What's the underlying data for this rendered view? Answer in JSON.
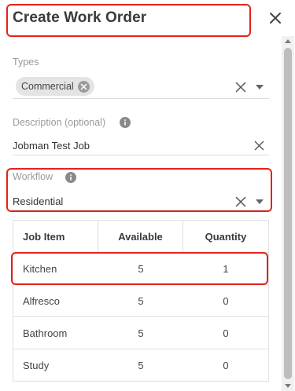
{
  "dialog": {
    "title": "Create Work Order"
  },
  "types": {
    "label": "Types",
    "selected_chip": "Commercial"
  },
  "description": {
    "label": "Description (optional)",
    "value": "Jobman Test Job"
  },
  "workflow": {
    "label": "Workflow",
    "value": "Residential"
  },
  "table": {
    "headers": [
      "Job Item",
      "Available",
      "Quantity"
    ],
    "rows": [
      {
        "item": "Kitchen",
        "available": "5",
        "quantity": "1"
      },
      {
        "item": "Alfresco",
        "available": "5",
        "quantity": "0"
      },
      {
        "item": "Bathroom",
        "available": "5",
        "quantity": "0"
      },
      {
        "item": "Study",
        "available": "5",
        "quantity": "0"
      }
    ]
  },
  "colors": {
    "annotation": "#e2231a",
    "chip_bg": "#e4e4e4",
    "label": "#9a9a9a"
  }
}
